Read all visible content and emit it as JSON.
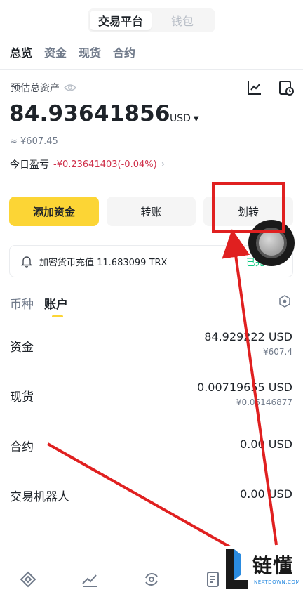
{
  "top_switch": {
    "tabs": [
      "交易平台",
      "钱包"
    ],
    "active": 0
  },
  "subnav": {
    "items": [
      "总览",
      "资金",
      "现货",
      "合约"
    ]
  },
  "overview": {
    "estimated_label": "预估总资产",
    "balance": "84.93641856",
    "currency": "USD",
    "cny_value": "≈ ¥607.45",
    "pnl_label": "今日盈亏",
    "pnl_value": "-¥0.23641403(-0.04%)"
  },
  "actions": {
    "add_funds": "添加资金",
    "transfer": "转账",
    "internal_transfer": "划转"
  },
  "notice": {
    "text": "加密货币充值 11.683099 TRX",
    "status": "已完"
  },
  "tabs2": [
    "币种",
    "账户"
  ],
  "accounts": [
    {
      "name": "资金",
      "amount": "84.929222 USD",
      "sub": "¥607.4"
    },
    {
      "name": "现货",
      "amount": "0.00719655 USD",
      "sub": "¥0.05146877"
    },
    {
      "name": "合约",
      "amount": "0.00 USD",
      "sub": ""
    },
    {
      "name": "交易机器人",
      "amount": "0.00 USD",
      "sub": ""
    }
  ],
  "watermark": {
    "title": "链懂",
    "sub": "NEATDOWN.COM"
  },
  "colors": {
    "accent": "#fcd535",
    "negative": "#cf304a",
    "positive": "#0ecb81",
    "annotation": "#e02020"
  }
}
